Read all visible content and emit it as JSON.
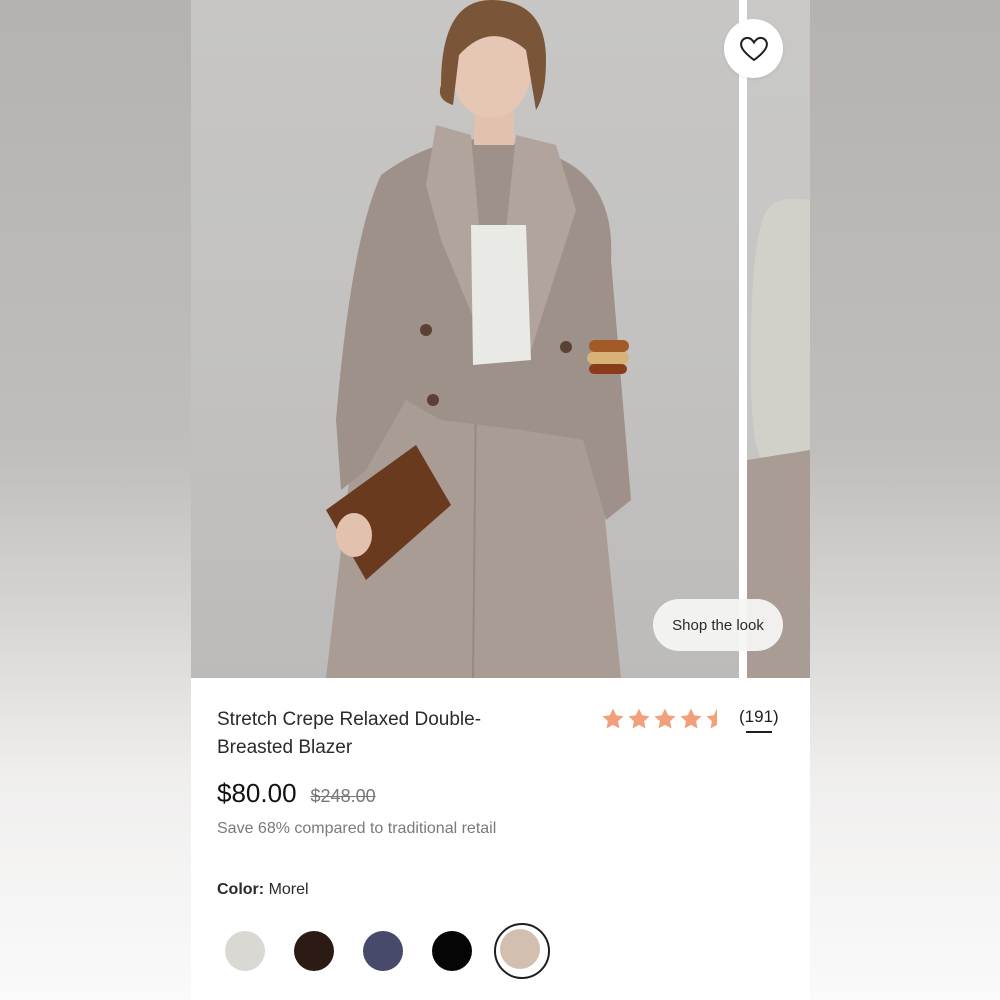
{
  "product": {
    "title": "Stretch Crepe Relaxed Double-Breasted Blazer",
    "price": "$80.00",
    "original_price": "$248.00",
    "savings_text": "Save 68% compared to traditional retail",
    "rating": 4.5,
    "rating_max": 5,
    "review_count": "(191)",
    "star_color": "#f2a07b"
  },
  "gallery": {
    "shop_the_look_label": "Shop the look",
    "favorite_icon": "heart-outline-icon"
  },
  "color": {
    "label": "Color:",
    "selected": "Morel",
    "swatches": [
      {
        "name": "cream",
        "hex": "#d9d8d3"
      },
      {
        "name": "dark-brown",
        "hex": "#2b1b14"
      },
      {
        "name": "navy",
        "hex": "#474a6b"
      },
      {
        "name": "black",
        "hex": "#050505"
      },
      {
        "name": "morel",
        "hex": "#d3bfb0",
        "selected": true
      }
    ]
  }
}
